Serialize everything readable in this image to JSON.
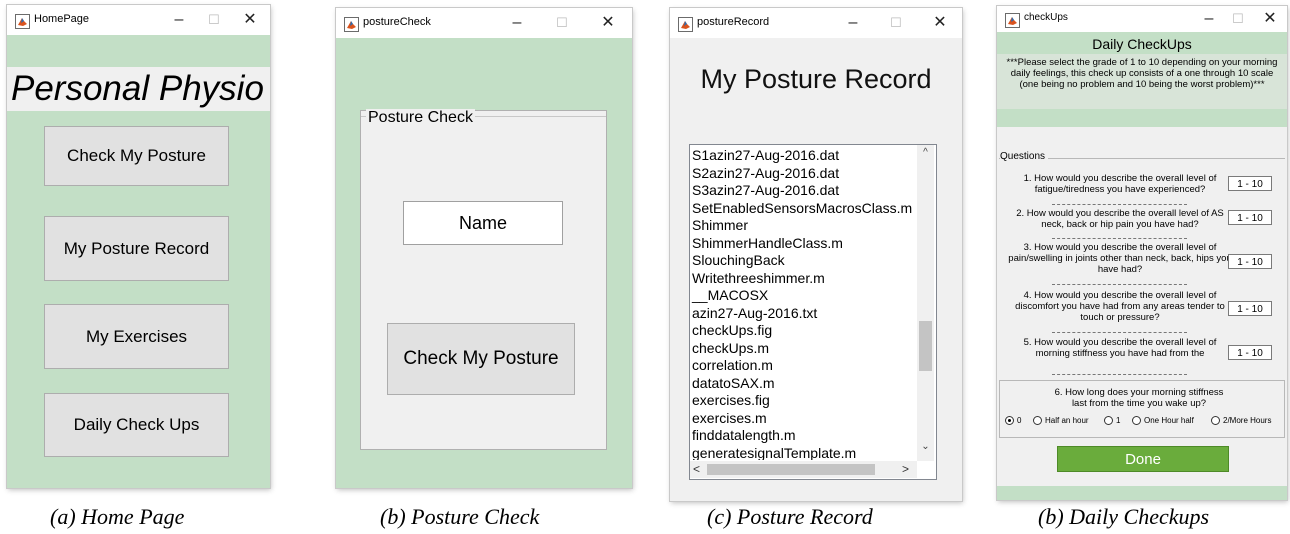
{
  "windows": {
    "home": {
      "title": "HomePage",
      "heading": "Personal Physio",
      "buttons": [
        "Check My Posture",
        "My Posture Record",
        "My Exercises",
        "Daily Check Ups"
      ],
      "caption": "(a)  Home Page"
    },
    "posture_check": {
      "title": "postureCheck",
      "panel_title": "Posture Check",
      "name_field": "Name",
      "button": "Check My Posture",
      "caption": "(b) Posture Check"
    },
    "posture_record": {
      "title": "postureRecord",
      "heading": "My Posture Record",
      "files": [
        "S1azin27-Aug-2016.dat",
        "S2azin27-Aug-2016.dat",
        "S3azin27-Aug-2016.dat",
        "SetEnabledSensorsMacrosClass.m",
        "Shimmer",
        "ShimmerHandleClass.m",
        "SlouchingBack",
        "Writethreeshimmer.m",
        "__MACOSX",
        "azin27-Aug-2016.txt",
        "checkUps.fig",
        "checkUps.m",
        "correlation.m",
        "datatoSAX.m",
        "exercises.fig",
        "exercises.m",
        "finddatalength.m",
        "generatesignalTemplate.m"
      ],
      "caption": "(c) Posture Record"
    },
    "checkups": {
      "title": "checkUps",
      "heading": "Daily CheckUps",
      "instructions": "***Please select the grade of 1 to 10 depending on your morning daily feelings, this check up consists of a one through 10 scale (one being no problem and 10 being the worst problem)***",
      "questions_label": "Questions",
      "questions": [
        {
          "text": "1. How would you describe the overall level of fatigue/tiredness you have experienced?",
          "value": "1 - 10"
        },
        {
          "text": "2. How would you describe the overall level of AS neck, back or hip pain you have had?",
          "value": "1 - 10"
        },
        {
          "text": "3. How would you describe the overall level of pain/swelling in joints other than neck, back, hips you have had?",
          "value": "1 - 10"
        },
        {
          "text": "4. How would you describe the overall level of discomfort you have had from any areas tender to touch or pressure?",
          "value": "1 - 10"
        },
        {
          "text": "5. How would you describe the overall level of morning stiffness you have had from the",
          "value": "1 - 10"
        }
      ],
      "q6": "6. How long does your morning stiffness last from the time you wake up?",
      "options": [
        "0",
        "Half an hour",
        "1",
        "One Hour half",
        "2/More Hours"
      ],
      "selected_option": "0",
      "done_button": "Done",
      "caption": "(b) Daily Checkups"
    }
  },
  "colors": {
    "panel_green": "#c3dfc6",
    "done_green": "#6aac3c"
  }
}
